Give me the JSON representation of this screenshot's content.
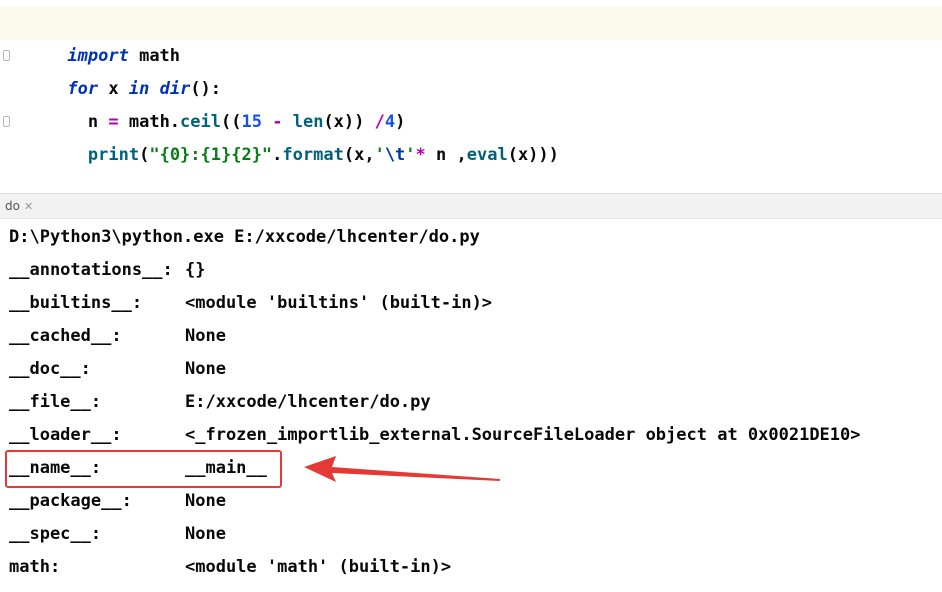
{
  "editor": {
    "line1": {
      "kw": "import",
      "rest": " math"
    },
    "line2": {
      "kw_for": "for",
      "sp1": " x ",
      "kw_in": "in",
      "sp2": " ",
      "fn_dir": "dir",
      "tail": "():"
    },
    "line3": {
      "indent": "  n ",
      "eq": "=",
      "sp": " math.",
      "fn_ceil": "ceil",
      "p1": "((",
      "num15": "15",
      "sp2": " ",
      "minus": "-",
      "sp3": " ",
      "bi_len": "len",
      "p2": "(x)) ",
      "div": "/",
      "num4": "4",
      "p3": ")"
    },
    "line4": {
      "indent": "  ",
      "bi_print": "print",
      "p1": "(",
      "str1": "\"{0}:{1}{2}\"",
      "dot": ".",
      "fn_format": "format",
      "p2": "(x,",
      "q1": "'",
      "esc": "\\t",
      "q2": "'",
      "mul": "*",
      "p3": " n ,",
      "bi_eval": "eval",
      "p4": "(x)))"
    }
  },
  "run_tab": {
    "label": "do",
    "close": "✕"
  },
  "console": {
    "command": "D:\\Python3\\python.exe E:/xxcode/lhcenter/do.py",
    "rows": [
      {
        "key": "__annotations__:",
        "value": "{}"
      },
      {
        "key": "__builtins__:",
        "value": "<module 'builtins' (built-in)>"
      },
      {
        "key": "__cached__:",
        "value": "None"
      },
      {
        "key": "__doc__:",
        "value": "None"
      },
      {
        "key": "__file__:",
        "value": "E:/xxcode/lhcenter/do.py"
      },
      {
        "key": "__loader__:",
        "value": "<_frozen_importlib_external.SourceFileLoader object at 0x0021DE10>"
      },
      {
        "key": "__name__:",
        "value": "__main__"
      },
      {
        "key": "__package__:",
        "value": "None"
      },
      {
        "key": "__spec__:",
        "value": "None"
      },
      {
        "key": "math:",
        "value": "<module 'math' (built-in)>"
      }
    ]
  },
  "annotation": {
    "box_color": "#e53935",
    "arrow_color": "#e53935"
  }
}
